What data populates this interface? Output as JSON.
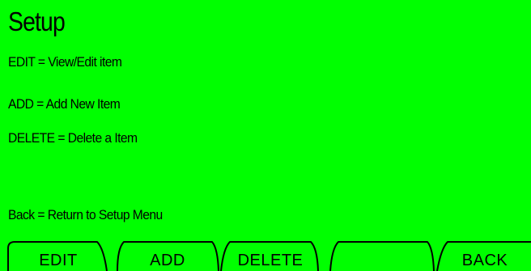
{
  "screen": {
    "title": "Setup",
    "background_color": "#00ff00",
    "text_color": "#000000"
  },
  "help": {
    "edit": "EDIT = View/Edit item",
    "add": "ADD = Add New Item",
    "delete": "DELETE = Delete a Item",
    "back": "Back = Return to Setup  Menu"
  },
  "softkeys": [
    {
      "label": "EDIT"
    },
    {
      "label": "ADD"
    },
    {
      "label": "DELETE"
    },
    {
      "label": ""
    },
    {
      "label": "BACK"
    }
  ]
}
